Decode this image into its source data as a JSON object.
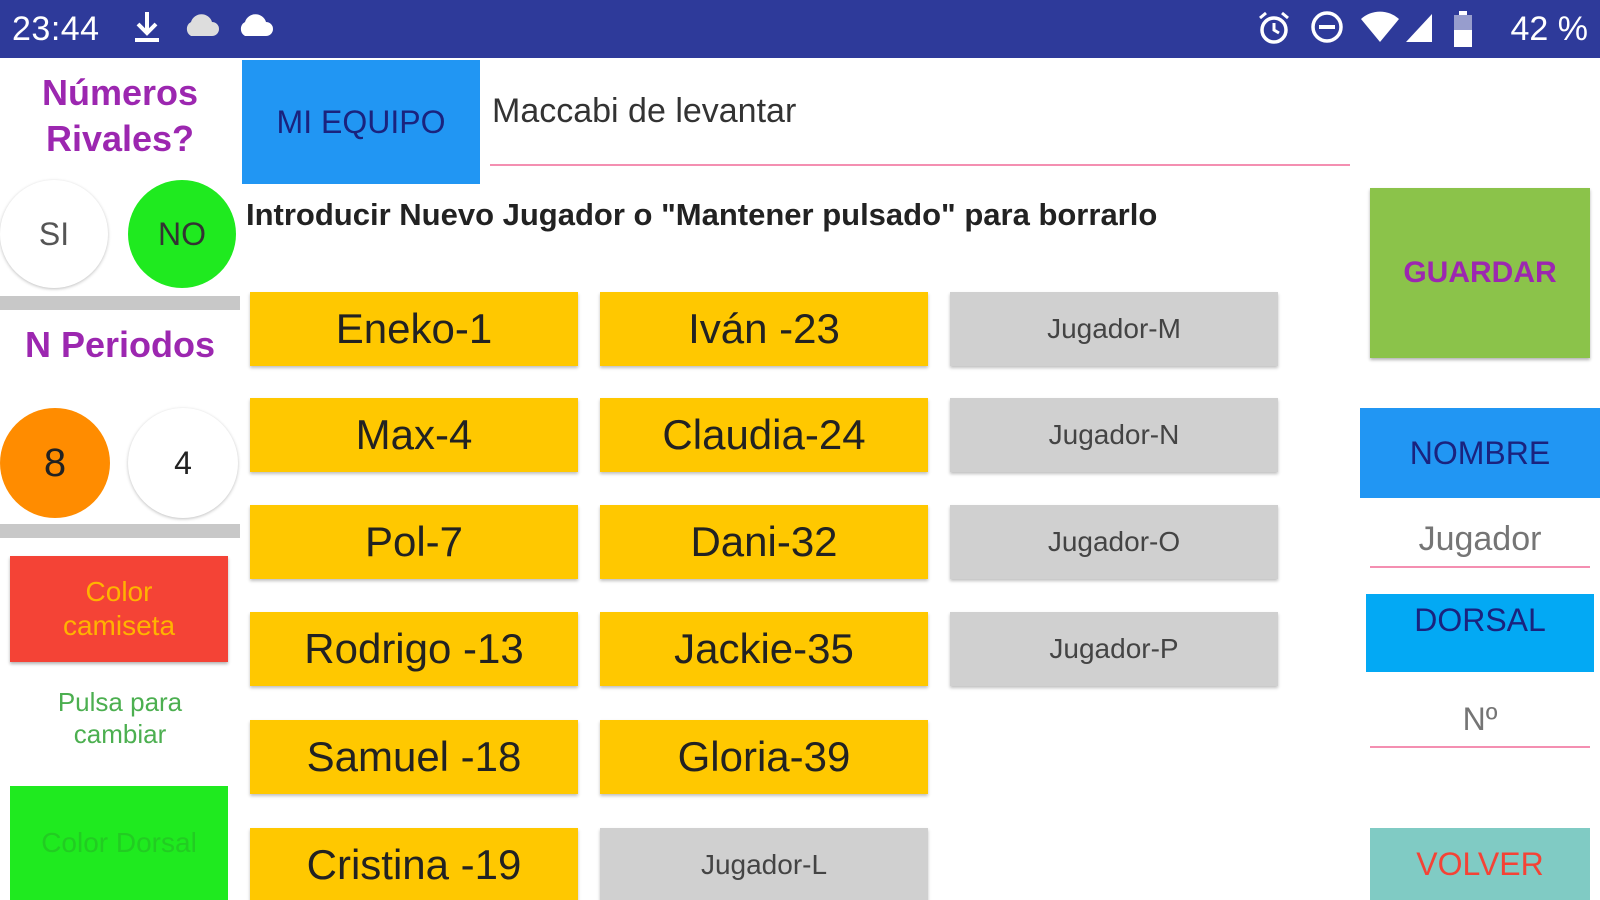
{
  "status_bar": {
    "time": "23:44",
    "left_icons": [
      "download-icon",
      "cloud-icon",
      "cloud-icon"
    ],
    "right_icons": [
      "alarm-icon",
      "do-not-disturb-icon",
      "wifi-icon",
      "signal-icon",
      "battery-icon"
    ],
    "battery": "42 %"
  },
  "left_panel": {
    "rivales_label_line1": "Números",
    "rivales_label_line2": "Rivales?",
    "si_label": "SI",
    "no_label": "NO",
    "periodos_label": "N Periodos",
    "periodos_option_a": "8",
    "periodos_option_b": "4",
    "color_camiseta_line1": "Color",
    "color_camiseta_line2": "camiseta",
    "pulsa_line1": "Pulsa para",
    "pulsa_line2": "cambiar",
    "color_dorsal_label": "Color Dorsal"
  },
  "header": {
    "mi_equipo_label": "MI EQUIPO",
    "team_name": "Maccabi de levantar",
    "instructions": "Introducir Nuevo Jugador o \"Mantener pulsado\" para borrarlo"
  },
  "players": {
    "c1": [
      "Eneko-1",
      "Max-4",
      "Pol-7",
      "Rodrigo -13",
      "Samuel -18",
      "Cristina -19"
    ],
    "c2": [
      "Iván -23",
      "Claudia-24",
      "Dani-32",
      "Jackie-35",
      "Gloria-39",
      "Jugador-L"
    ],
    "c3": [
      "Jugador-M",
      "Jugador-N",
      "Jugador-O",
      "Jugador-P"
    ]
  },
  "right_panel": {
    "guardar_label": "GUARDAR",
    "nombre_label": "NOMBRE",
    "nombre_placeholder": "Jugador",
    "dorsal_label": "DORSAL",
    "dorsal_placeholder": "Nº",
    "volver_label": "VOLVER"
  },
  "colors": {
    "status_bar": "#2e3a9a",
    "player_filled": "#ffc800",
    "player_empty": "#d0d0d0",
    "accent_purple": "#9c27b0",
    "selected_green": "#1fea1f",
    "selected_orange": "#ff8c00"
  }
}
